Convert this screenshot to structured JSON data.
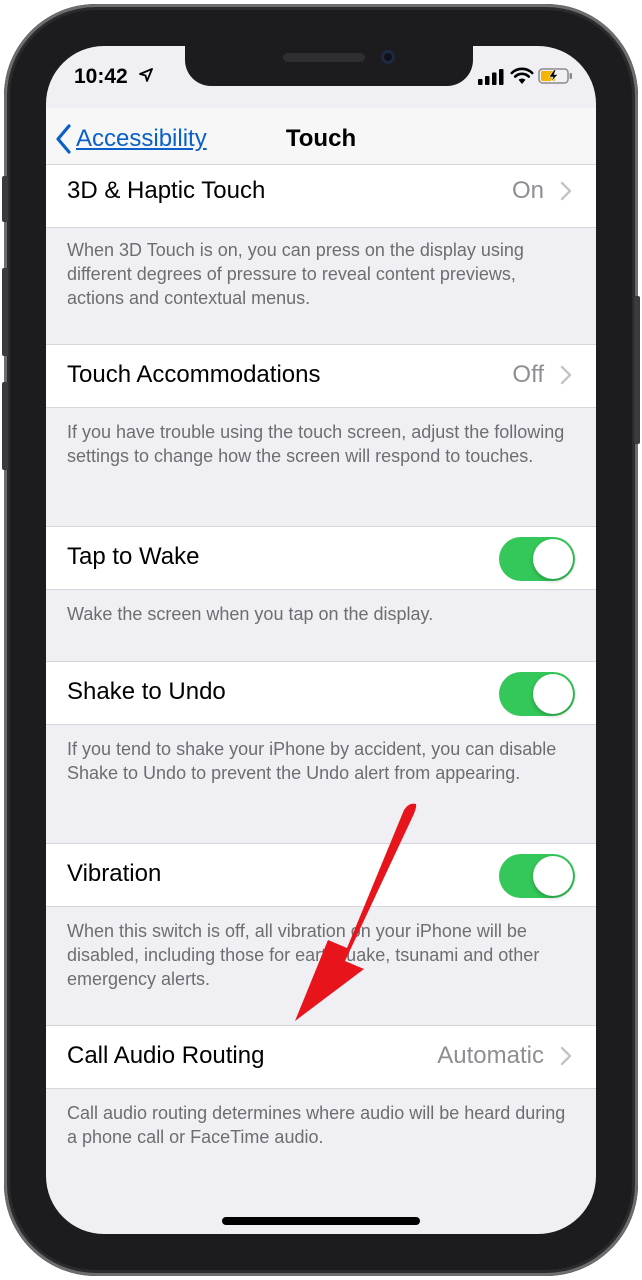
{
  "status_bar": {
    "time": "10:42",
    "icons": [
      "location-arrow-icon",
      "cellular-signal-icon",
      "wifi-icon",
      "battery-charging-icon"
    ]
  },
  "navbar": {
    "back_label": "Accessibility",
    "title": "Touch"
  },
  "settings": [
    {
      "label": "3D & Haptic Touch",
      "value": "On",
      "control": "chevron",
      "footer": "When 3D Touch is on, you can press on the display using different degrees of pressure to reveal content previews, actions and contextual menus."
    },
    {
      "label": "Touch Accommodations",
      "value": "Off",
      "control": "chevron",
      "footer": "If you have trouble using the touch screen, adjust the following settings to change how the screen will respond to touches."
    },
    {
      "label": "Tap to Wake",
      "control": "toggle",
      "on": true,
      "footer": "Wake the screen when you tap on the display."
    },
    {
      "label": "Shake to Undo",
      "control": "toggle",
      "on": true,
      "footer": "If you tend to shake your iPhone by accident, you can disable Shake to Undo to prevent the Undo alert from appearing."
    },
    {
      "label": "Vibration",
      "control": "toggle",
      "on": true,
      "footer": "When this switch is off, all vibration on your iPhone will be disabled, including those for earthquake, tsunami and other emergency alerts."
    },
    {
      "label": "Call Audio Routing",
      "value": "Automatic",
      "control": "chevron",
      "footer": "Call audio routing determines where audio will be heard during a phone call or FaceTime audio."
    }
  ],
  "colors": {
    "accent": "#0a60c8",
    "toggle_on": "#34c759",
    "annotation_arrow": "#e8141c",
    "group_background": "#efeff4"
  }
}
